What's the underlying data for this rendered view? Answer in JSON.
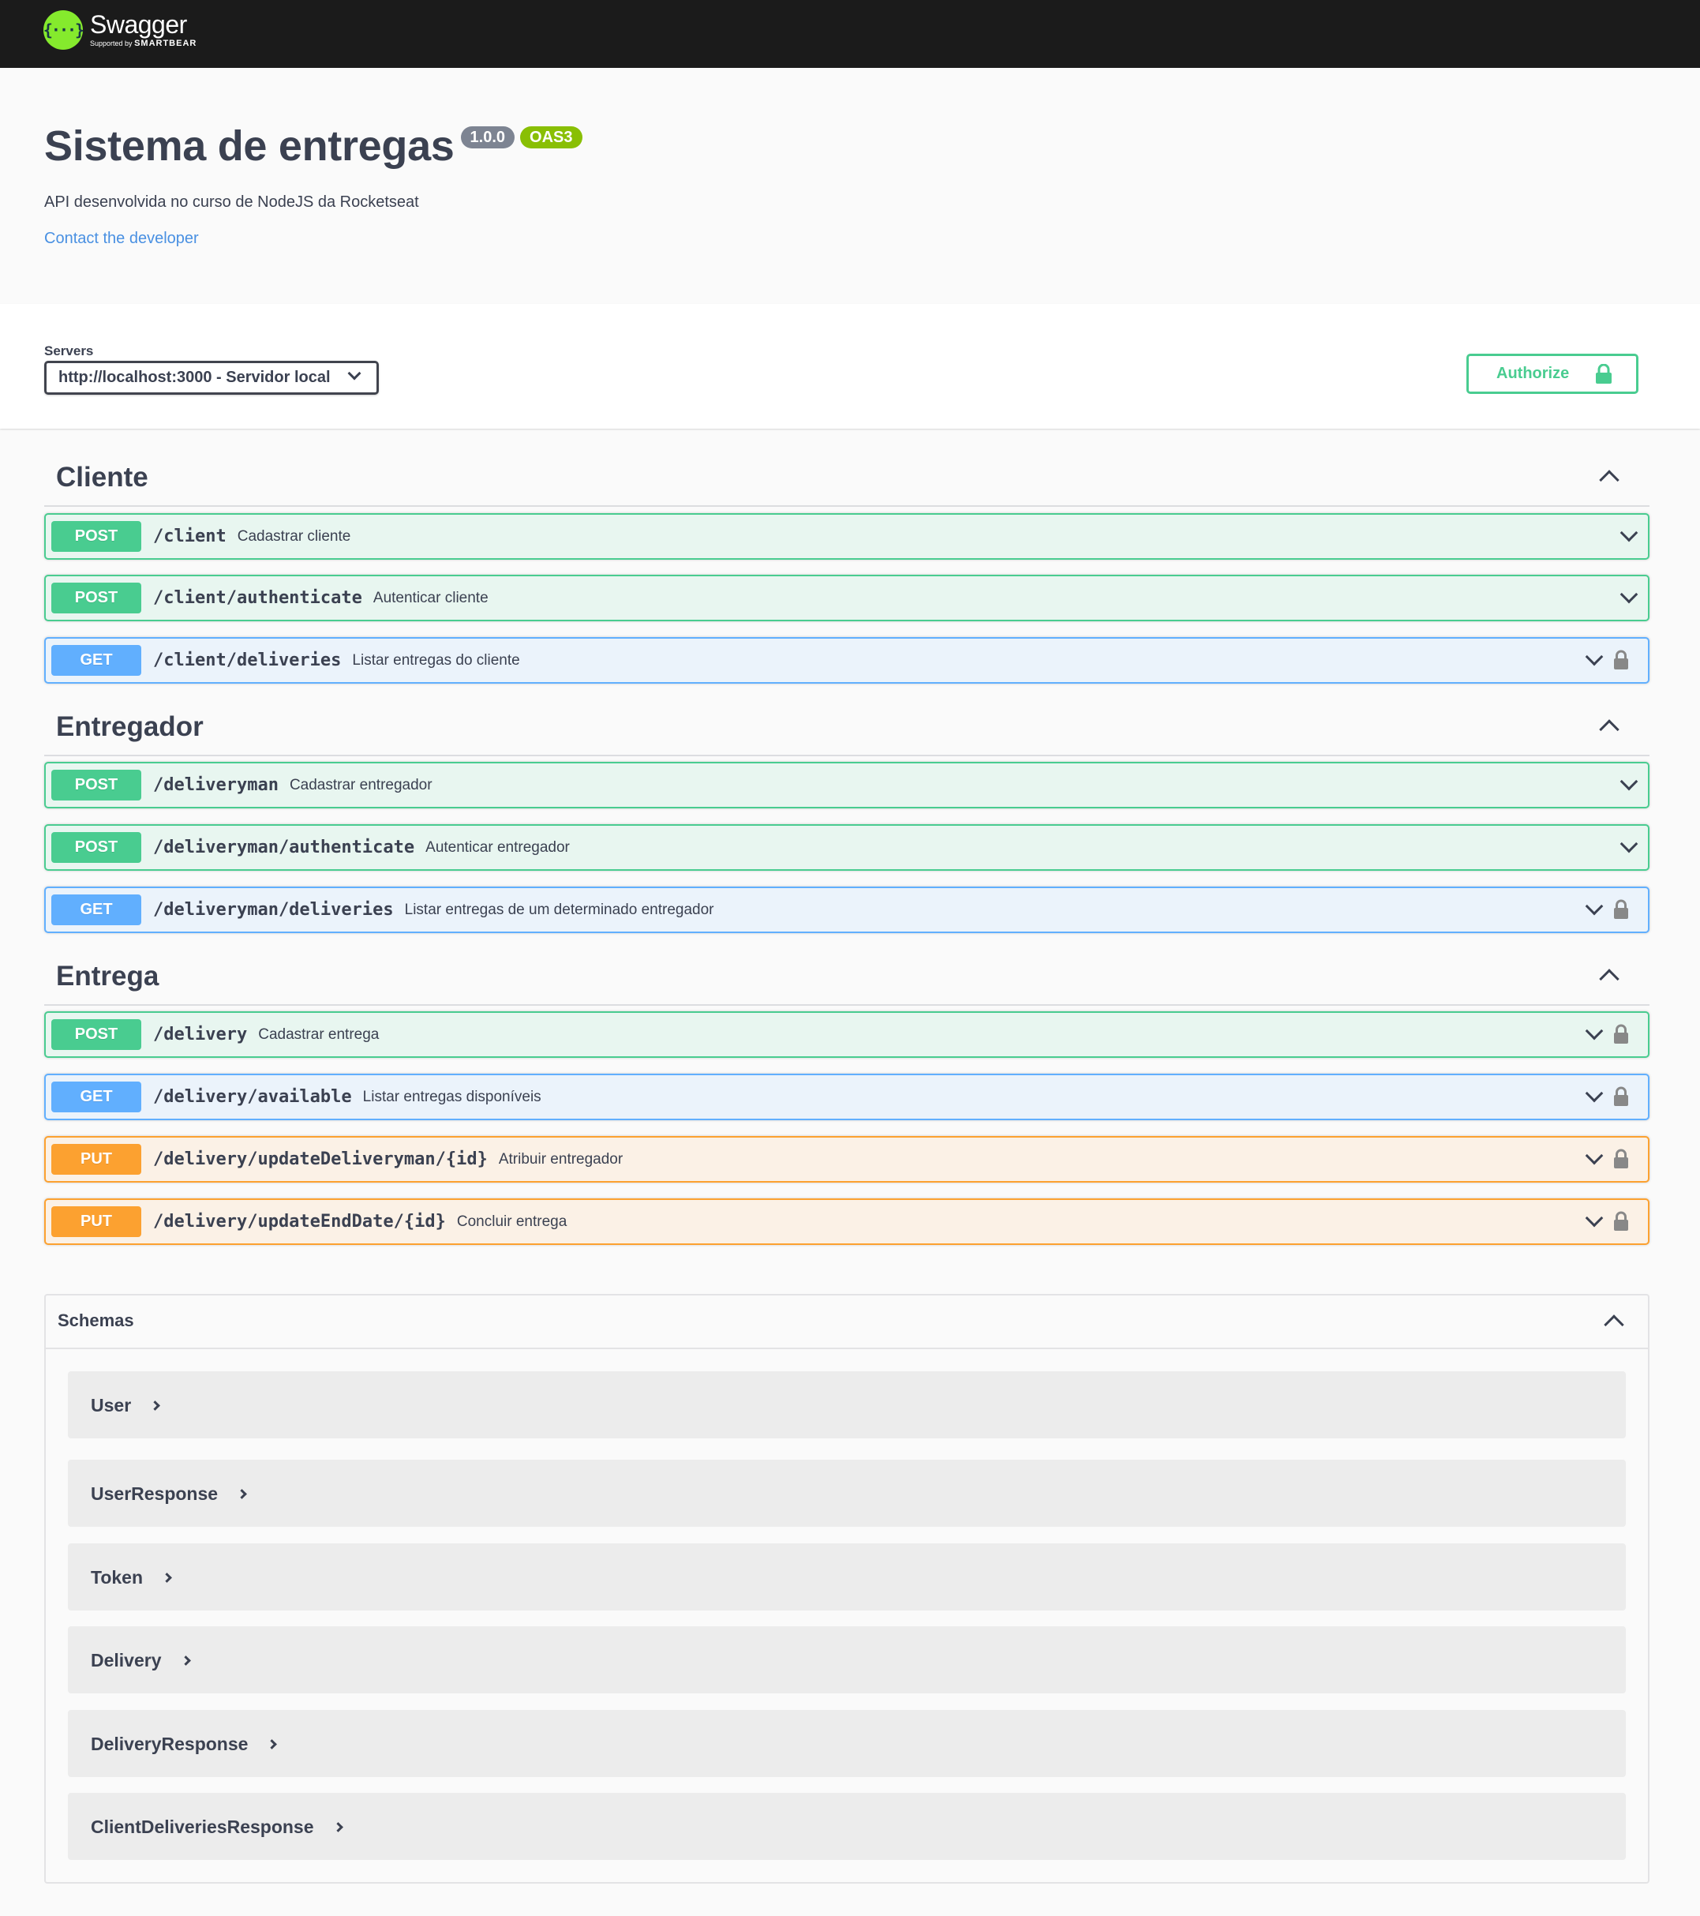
{
  "topbar": {
    "logo_name": "Swagger",
    "logo_sub_prefix": "Supported by",
    "logo_sub_brand": "SMARTBEAR",
    "logo_icon": "swagger-logo-icon"
  },
  "info": {
    "title": "Sistema de entregas",
    "version": "1.0.0",
    "oas": "OAS3",
    "description": "API desenvolvida no curso de NodeJS da Rocketseat",
    "contact_link": "Contact the developer"
  },
  "servers": {
    "label": "Servers",
    "selected": "http://localhost:3000 - Servidor local",
    "authorize_label": "Authorize"
  },
  "tags": [
    {
      "name": "Cliente",
      "operations": [
        {
          "method": "POST",
          "path": "/client",
          "summary": "Cadastrar cliente",
          "locked": false
        },
        {
          "method": "POST",
          "path": "/client/authenticate",
          "summary": "Autenticar cliente",
          "locked": false
        },
        {
          "method": "GET",
          "path": "/client/deliveries",
          "summary": "Listar entregas do cliente",
          "locked": true
        }
      ]
    },
    {
      "name": "Entregador",
      "operations": [
        {
          "method": "POST",
          "path": "/deliveryman",
          "summary": "Cadastrar entregador",
          "locked": false
        },
        {
          "method": "POST",
          "path": "/deliveryman/authenticate",
          "summary": "Autenticar entregador",
          "locked": false
        },
        {
          "method": "GET",
          "path": "/deliveryman/deliveries",
          "summary": "Listar entregas de um determinado entregador",
          "locked": true
        }
      ]
    },
    {
      "name": "Entrega",
      "operations": [
        {
          "method": "POST",
          "path": "/delivery",
          "summary": "Cadastrar entrega",
          "locked": true
        },
        {
          "method": "GET",
          "path": "/delivery/available",
          "summary": "Listar entregas disponíveis",
          "locked": true
        },
        {
          "method": "PUT",
          "path": "/delivery/updateDeliveryman/{id}",
          "summary": "Atribuir entregador",
          "locked": true
        },
        {
          "method": "PUT",
          "path": "/delivery/updateEndDate/{id}",
          "summary": "Concluir entrega",
          "locked": true
        }
      ]
    }
  ],
  "schemas": {
    "title": "Schemas",
    "models": [
      "User",
      "UserResponse",
      "Token",
      "Delivery",
      "DeliveryResponse",
      "ClientDeliveriesResponse"
    ]
  },
  "colors": {
    "post": "#49cc90",
    "get": "#61affe",
    "put": "#fca130",
    "topbar": "#1b1b1b",
    "link": "#4990e2",
    "version_badge": "#7d8492",
    "oas_badge": "#89bf04"
  }
}
